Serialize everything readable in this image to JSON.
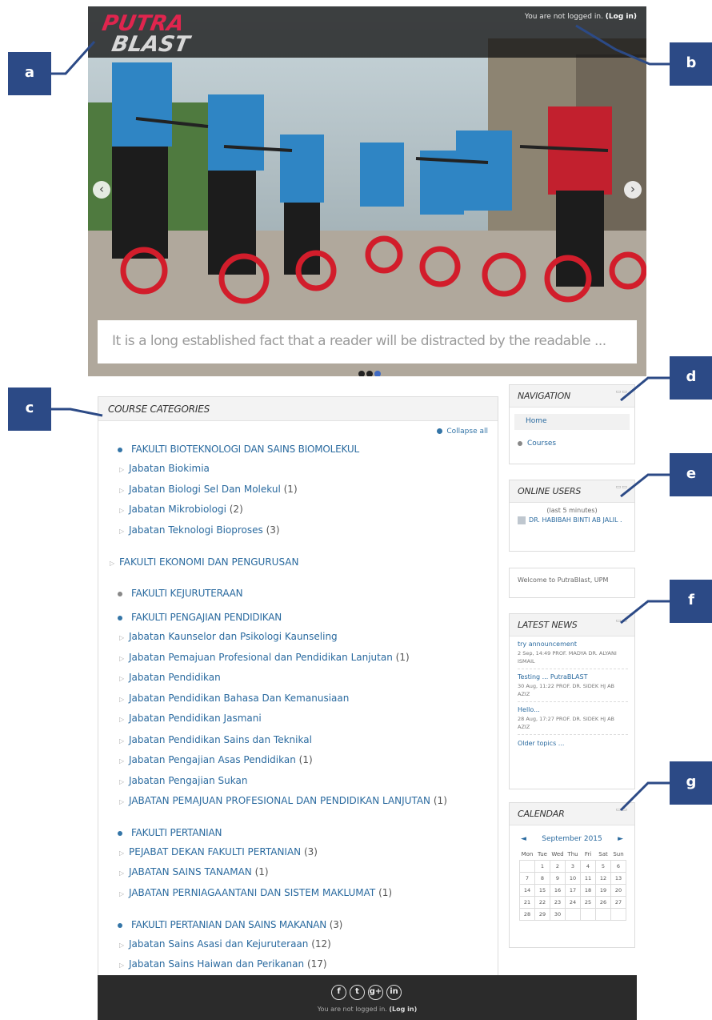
{
  "header": {
    "logo_top": "PUTRA",
    "logo_bottom": "BLAST",
    "login_status": "You are not logged in.",
    "login_link": "(Log in)"
  },
  "slider": {
    "caption": "It is a long established fact that a reader will be distracted by the readable ...",
    "prev_arrow": "‹",
    "next_arrow": "›"
  },
  "callouts": {
    "a": "a",
    "b": "b",
    "c": "c",
    "d": "d",
    "e": "e",
    "f": "f",
    "g": "g"
  },
  "course_categories": {
    "title": "COURSE CATEGORIES",
    "collapse_label": "Collapse all",
    "rows": [
      {
        "label": "FAKULTI BIOTEKNOLOGI DAN SAINS BIOMOLEKUL",
        "count": ""
      },
      {
        "label": "Jabatan Biokimia",
        "count": ""
      },
      {
        "label": "Jabatan Biologi Sel Dan Molekul",
        "count": "(1)"
      },
      {
        "label": "Jabatan Mikrobiologi",
        "count": "(2)"
      },
      {
        "label": "Jabatan Teknologi Bioproses",
        "count": "(3)"
      },
      {
        "label": "FAKULTI EKONOMI DAN PENGURUSAN",
        "count": ""
      },
      {
        "label": "FAKULTI KEJURUTERAAN",
        "count": ""
      },
      {
        "label": "FAKULTI PENGAJIAN PENDIDIKAN",
        "count": ""
      },
      {
        "label": "Jabatan Kaunselor dan Psikologi Kaunseling",
        "count": ""
      },
      {
        "label": "Jabatan Pemajuan Profesional dan Pendidikan Lanjutan",
        "count": "(1)"
      },
      {
        "label": "Jabatan Pendidikan",
        "count": ""
      },
      {
        "label": "Jabatan Pendidikan Bahasa Dan Kemanusiaan",
        "count": ""
      },
      {
        "label": "Jabatan Pendidikan Jasmani",
        "count": ""
      },
      {
        "label": "Jabatan Pendidikan Sains dan Teknikal",
        "count": ""
      },
      {
        "label": "Jabatan Pengajian Asas Pendidikan",
        "count": "(1)"
      },
      {
        "label": "Jabatan Pengajian Sukan",
        "count": ""
      },
      {
        "label": "JABATAN PEMAJUAN PROFESIONAL DAN PENDIDIKAN LANJUTAN",
        "count": "(1)"
      },
      {
        "label": "FAKULTI PERTANIAN",
        "count": ""
      },
      {
        "label": "PEJABAT DEKAN FAKULTI PERTANIAN",
        "count": "(3)"
      },
      {
        "label": "JABATAN SAINS TANAMAN",
        "count": "(1)"
      },
      {
        "label": "JABATAN PERNIAGAANTANI DAN SISTEM MAKLUMAT",
        "count": "(1)"
      },
      {
        "label": "FAKULTI PERTANIAN DAN SAINS MAKANAN",
        "count": "(3)"
      },
      {
        "label": "Jabatan Sains Asasi dan Kejuruteraan",
        "count": "(12)"
      },
      {
        "label": "Jabatan Sains Haiwan dan Perikanan",
        "count": "(17)"
      }
    ]
  },
  "navigation": {
    "title": "NAVIGATION",
    "home": "Home",
    "courses": "Courses"
  },
  "online_users": {
    "title": "ONLINE USERS",
    "note": "(last 5 minutes)",
    "user": "DR. HABIBAH BINTI AB JALIL ."
  },
  "welcome": {
    "text": "Welcome to PutraBlast, UPM"
  },
  "latest_news": {
    "title": "LATEST NEWS",
    "items": [
      {
        "title": "try announcement",
        "meta": "2 Sep, 14:49  PROF. MADYA DR. ALYANI ISMAIL"
      },
      {
        "title": "Testing ... PutraBLAST",
        "meta": "30 Aug, 11:22  PROF. DR. SIDEK HJ AB AZIZ"
      },
      {
        "title": "Hello...",
        "meta": "28 Aug, 17:27  PROF. DR. SIDEK HJ AB AZIZ"
      }
    ],
    "older": "Older topics ..."
  },
  "calendar": {
    "title": "CALENDAR",
    "prev": "◄",
    "next": "►",
    "month": "September 2015",
    "weekdays": [
      "Mon",
      "Tue",
      "Wed",
      "Thu",
      "Fri",
      "Sat",
      "Sun"
    ],
    "weeks": [
      [
        "",
        "1",
        "2",
        "3",
        "4",
        "5",
        "6"
      ],
      [
        "7",
        "8",
        "9",
        "10",
        "11",
        "12",
        "13"
      ],
      [
        "14",
        "15",
        "16",
        "17",
        "18",
        "19",
        "20"
      ],
      [
        "21",
        "22",
        "23",
        "24",
        "25",
        "26",
        "27"
      ],
      [
        "28",
        "29",
        "30",
        "",
        "",
        "",
        ""
      ]
    ]
  },
  "footer": {
    "social": [
      "f",
      "t",
      "g+",
      "in"
    ],
    "login_status": "You are not logged in.",
    "login_link": "(Log in)"
  }
}
